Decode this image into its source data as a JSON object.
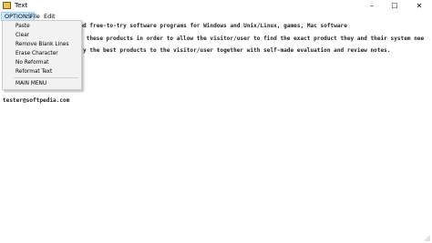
{
  "window": {
    "title": "Text",
    "accent_icon_color": "#e8c44a"
  },
  "window_controls": {
    "minimize": "–",
    "maximize": "☐",
    "close": "✕"
  },
  "menubar": {
    "options": "OPTIONS",
    "file": "File",
    "edit": "Edit"
  },
  "options_menu": {
    "items": [
      "Paste",
      "Clear",
      "Remove Blank Lines",
      "Erase Character",
      "No Reformat",
      "Reformat Text"
    ],
    "main_menu": "MAIN MENU"
  },
  "editor": {
    "lines": [
      "f over 1,300,000 free and free-to-try software programs for Windows and Unix/Linux, games, Mac software",
      " these products in order to allow the visitor/user to find the exact product they and their system nee",
      "y the best products to the visitor/user together with self-made evaluation and review notes.",
      "tester@softpedia.com"
    ]
  }
}
